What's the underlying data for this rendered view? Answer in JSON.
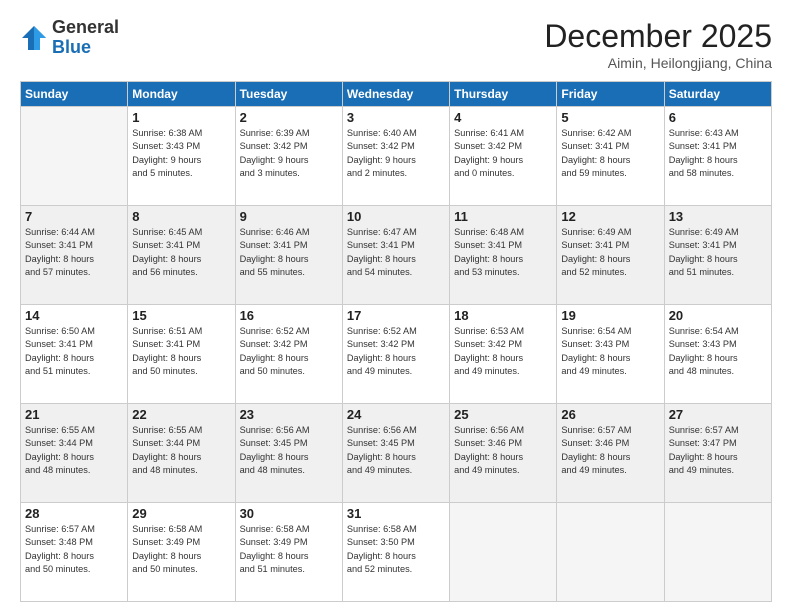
{
  "header": {
    "logo_general": "General",
    "logo_blue": "Blue",
    "month_title": "December 2025",
    "location": "Aimin, Heilongjiang, China"
  },
  "days_of_week": [
    "Sunday",
    "Monday",
    "Tuesday",
    "Wednesday",
    "Thursday",
    "Friday",
    "Saturday"
  ],
  "weeks": [
    [
      {
        "day": "",
        "info": ""
      },
      {
        "day": "1",
        "info": "Sunrise: 6:38 AM\nSunset: 3:43 PM\nDaylight: 9 hours\nand 5 minutes."
      },
      {
        "day": "2",
        "info": "Sunrise: 6:39 AM\nSunset: 3:42 PM\nDaylight: 9 hours\nand 3 minutes."
      },
      {
        "day": "3",
        "info": "Sunrise: 6:40 AM\nSunset: 3:42 PM\nDaylight: 9 hours\nand 2 minutes."
      },
      {
        "day": "4",
        "info": "Sunrise: 6:41 AM\nSunset: 3:42 PM\nDaylight: 9 hours\nand 0 minutes."
      },
      {
        "day": "5",
        "info": "Sunrise: 6:42 AM\nSunset: 3:41 PM\nDaylight: 8 hours\nand 59 minutes."
      },
      {
        "day": "6",
        "info": "Sunrise: 6:43 AM\nSunset: 3:41 PM\nDaylight: 8 hours\nand 58 minutes."
      }
    ],
    [
      {
        "day": "7",
        "info": "Sunrise: 6:44 AM\nSunset: 3:41 PM\nDaylight: 8 hours\nand 57 minutes."
      },
      {
        "day": "8",
        "info": "Sunrise: 6:45 AM\nSunset: 3:41 PM\nDaylight: 8 hours\nand 56 minutes."
      },
      {
        "day": "9",
        "info": "Sunrise: 6:46 AM\nSunset: 3:41 PM\nDaylight: 8 hours\nand 55 minutes."
      },
      {
        "day": "10",
        "info": "Sunrise: 6:47 AM\nSunset: 3:41 PM\nDaylight: 8 hours\nand 54 minutes."
      },
      {
        "day": "11",
        "info": "Sunrise: 6:48 AM\nSunset: 3:41 PM\nDaylight: 8 hours\nand 53 minutes."
      },
      {
        "day": "12",
        "info": "Sunrise: 6:49 AM\nSunset: 3:41 PM\nDaylight: 8 hours\nand 52 minutes."
      },
      {
        "day": "13",
        "info": "Sunrise: 6:49 AM\nSunset: 3:41 PM\nDaylight: 8 hours\nand 51 minutes."
      }
    ],
    [
      {
        "day": "14",
        "info": "Sunrise: 6:50 AM\nSunset: 3:41 PM\nDaylight: 8 hours\nand 51 minutes."
      },
      {
        "day": "15",
        "info": "Sunrise: 6:51 AM\nSunset: 3:41 PM\nDaylight: 8 hours\nand 50 minutes."
      },
      {
        "day": "16",
        "info": "Sunrise: 6:52 AM\nSunset: 3:42 PM\nDaylight: 8 hours\nand 50 minutes."
      },
      {
        "day": "17",
        "info": "Sunrise: 6:52 AM\nSunset: 3:42 PM\nDaylight: 8 hours\nand 49 minutes."
      },
      {
        "day": "18",
        "info": "Sunrise: 6:53 AM\nSunset: 3:42 PM\nDaylight: 8 hours\nand 49 minutes."
      },
      {
        "day": "19",
        "info": "Sunrise: 6:54 AM\nSunset: 3:43 PM\nDaylight: 8 hours\nand 49 minutes."
      },
      {
        "day": "20",
        "info": "Sunrise: 6:54 AM\nSunset: 3:43 PM\nDaylight: 8 hours\nand 48 minutes."
      }
    ],
    [
      {
        "day": "21",
        "info": "Sunrise: 6:55 AM\nSunset: 3:44 PM\nDaylight: 8 hours\nand 48 minutes."
      },
      {
        "day": "22",
        "info": "Sunrise: 6:55 AM\nSunset: 3:44 PM\nDaylight: 8 hours\nand 48 minutes."
      },
      {
        "day": "23",
        "info": "Sunrise: 6:56 AM\nSunset: 3:45 PM\nDaylight: 8 hours\nand 48 minutes."
      },
      {
        "day": "24",
        "info": "Sunrise: 6:56 AM\nSunset: 3:45 PM\nDaylight: 8 hours\nand 49 minutes."
      },
      {
        "day": "25",
        "info": "Sunrise: 6:56 AM\nSunset: 3:46 PM\nDaylight: 8 hours\nand 49 minutes."
      },
      {
        "day": "26",
        "info": "Sunrise: 6:57 AM\nSunset: 3:46 PM\nDaylight: 8 hours\nand 49 minutes."
      },
      {
        "day": "27",
        "info": "Sunrise: 6:57 AM\nSunset: 3:47 PM\nDaylight: 8 hours\nand 49 minutes."
      }
    ],
    [
      {
        "day": "28",
        "info": "Sunrise: 6:57 AM\nSunset: 3:48 PM\nDaylight: 8 hours\nand 50 minutes."
      },
      {
        "day": "29",
        "info": "Sunrise: 6:58 AM\nSunset: 3:49 PM\nDaylight: 8 hours\nand 50 minutes."
      },
      {
        "day": "30",
        "info": "Sunrise: 6:58 AM\nSunset: 3:49 PM\nDaylight: 8 hours\nand 51 minutes."
      },
      {
        "day": "31",
        "info": "Sunrise: 6:58 AM\nSunset: 3:50 PM\nDaylight: 8 hours\nand 52 minutes."
      },
      {
        "day": "",
        "info": ""
      },
      {
        "day": "",
        "info": ""
      },
      {
        "day": "",
        "info": ""
      }
    ]
  ]
}
